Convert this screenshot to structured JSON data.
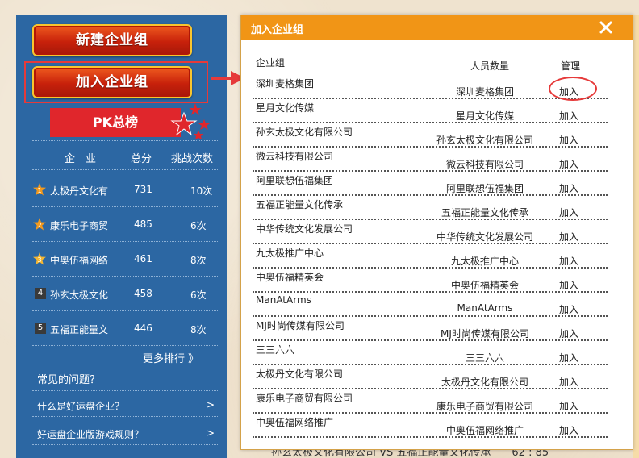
{
  "left_panel": {
    "new_group_button": "新建企业组",
    "join_group_button": "加入企业组",
    "pk_banner": "PK总榜",
    "rank_header": {
      "company": "企　业",
      "score": "总分",
      "challenges": "挑战次数"
    },
    "rankings": [
      {
        "rank": "1",
        "name": "太极丹文化有",
        "score": "731",
        "times": "10次"
      },
      {
        "rank": "2",
        "name": "康乐电子商贸",
        "score": "485",
        "times": "6次"
      },
      {
        "rank": "3",
        "name": "中奥伍福网络",
        "score": "461",
        "times": "8次"
      },
      {
        "rank": "4",
        "name": "孙玄太极文化",
        "score": "458",
        "times": "6次"
      },
      {
        "rank": "5",
        "name": "五福正能量文",
        "score": "446",
        "times": "8次"
      }
    ],
    "more_rankings": "更多排行 》",
    "faq_title": "常见的问题？",
    "faq_items": [
      {
        "text": "什么是好运盘企业？",
        "arrow": ">"
      },
      {
        "text": "好运盘企业版游戏规则？",
        "arrow": ">"
      }
    ]
  },
  "modal": {
    "title": "加入企业组",
    "close_icon": "close-icon",
    "columns": {
      "group": "企业组",
      "members": "人员数量",
      "manage": "管理"
    },
    "groups": [
      {
        "name": "深圳麦格集团",
        "members": "深圳麦格集团",
        "action": "加入"
      },
      {
        "name": "星月文化传媒",
        "members": "星月文化传媒",
        "action": "加入"
      },
      {
        "name": "孙玄太极文化有限公司",
        "members": "孙玄太极文化有限公司",
        "action": "加入"
      },
      {
        "name": "微云科技有限公司",
        "members": "微云科技有限公司",
        "action": "加入"
      },
      {
        "name": "阿里联想伍福集团",
        "members": "阿里联想伍福集团",
        "action": "加入"
      },
      {
        "name": "五福正能量文化传承",
        "members": "五福正能量文化传承",
        "action": "加入"
      },
      {
        "name": "中华传统文化发展公司",
        "members": "中华传统文化发展公司",
        "action": "加入"
      },
      {
        "name": "九太极推广中心",
        "members": "九太极推广中心",
        "action": "加入"
      },
      {
        "name": "中奥伍福精英会",
        "members": "中奥伍福精英会",
        "action": "加入"
      },
      {
        "name": "ManAtArms",
        "members": "ManAtArms",
        "action": "加入"
      },
      {
        "name": "MJ时尚传媒有限公司",
        "members": "MJ时尚传媒有限公司",
        "action": "加入"
      },
      {
        "name": "三三六六",
        "members": "三三六六",
        "action": "加入"
      },
      {
        "name": "太极丹文化有限公司",
        "members": "太极丹文化有限公司",
        "action": "加入"
      },
      {
        "name": "康乐电子商贸有限公司",
        "members": "康乐电子商贸有限公司",
        "action": "加入"
      },
      {
        "name": "中奥伍福网络推广",
        "members": "中奥伍福网络推广",
        "action": "加入"
      }
    ]
  },
  "background_text": "孙玄太极文化有限公司 VS 五福正能量文化传承　　62 : 85",
  "colors": {
    "panel_blue": "#2c67a3",
    "modal_header_orange": "#f19516",
    "button_red": "#c8210b",
    "highlight_red": "#e63a3a"
  }
}
